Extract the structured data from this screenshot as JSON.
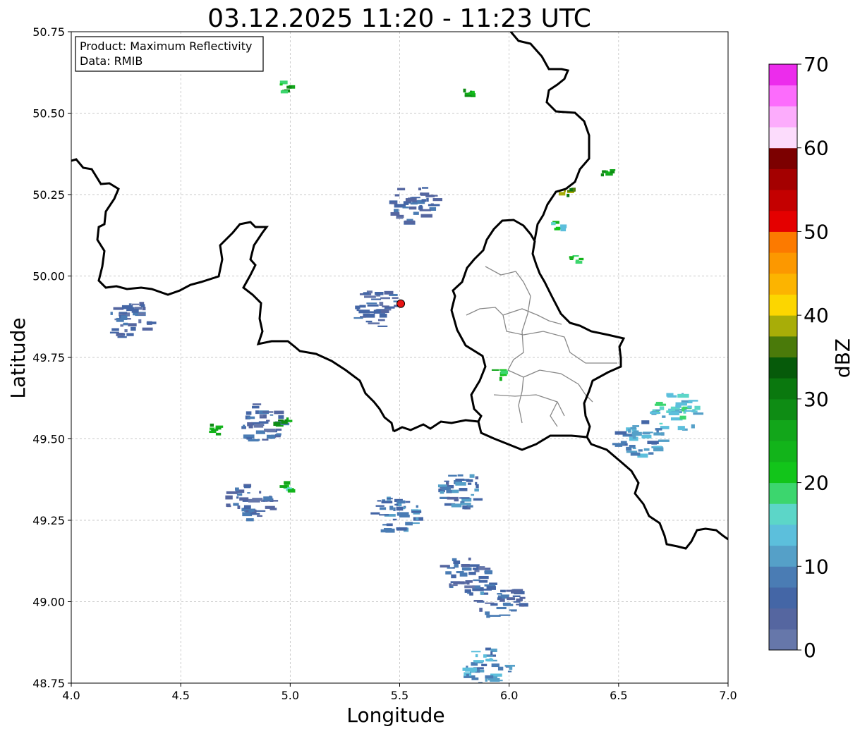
{
  "chart_data": {
    "type": "heatmap",
    "title": "03.12.2025 11:20 - 11:23 UTC",
    "xlabel": "Longitude",
    "ylabel": "Latitude",
    "xlim": [
      4.0,
      7.0
    ],
    "ylim": [
      48.75,
      50.75
    ],
    "x_ticks": [
      "4.0",
      "4.5",
      "5.0",
      "5.5",
      "6.0",
      "6.5",
      "7.0"
    ],
    "y_ticks": [
      "48.75",
      "49.00",
      "49.25",
      "49.50",
      "49.75",
      "50.00",
      "50.25",
      "50.50",
      "50.75"
    ],
    "grid": true,
    "annotation_lines": [
      "Product: Maximum Reflectivity",
      "Data: RMIB"
    ],
    "radar_site": {
      "lon": 5.505,
      "lat": 49.915
    },
    "colorbar": {
      "label": "dBZ",
      "min": 0,
      "max": 70,
      "ticks": [
        "0",
        "10",
        "20",
        "30",
        "40",
        "50",
        "60",
        "70"
      ],
      "colors": [
        "#6677aa",
        "#5566a0",
        "#4466a6",
        "#4a7cb4",
        "#55a0c8",
        "#5cbfdc",
        "#5cd6c8",
        "#3cd66e",
        "#12c51a",
        "#12b41a",
        "#12a61a",
        "#0e8c14",
        "#0a780e",
        "#065a0a",
        "#4a7a0a",
        "#a8ad08",
        "#fcd600",
        "#fcb400",
        "#fc9800",
        "#fc7a00",
        "#e40000",
        "#c40000",
        "#a40000",
        "#7c0000",
        "#fcdcfc",
        "#fcacfc",
        "#fc6cfc",
        "#ec2cec"
      ]
    },
    "echo_regions": [
      {
        "lon": 5.8,
        "lat": 49.34,
        "dbz": 8
      },
      {
        "lon": 5.48,
        "lat": 49.27,
        "dbz": 9
      },
      {
        "lon": 5.9,
        "lat": 48.8,
        "dbz": 10
      },
      {
        "lon": 5.96,
        "lat": 49.0,
        "dbz": 7
      },
      {
        "lon": 5.8,
        "lat": 49.08,
        "dbz": 6
      },
      {
        "lon": 5.57,
        "lat": 50.22,
        "dbz": 6
      },
      {
        "lon": 5.4,
        "lat": 49.9,
        "dbz": 5
      },
      {
        "lon": 4.87,
        "lat": 49.55,
        "dbz": 6
      },
      {
        "lon": 4.82,
        "lat": 49.3,
        "dbz": 6
      },
      {
        "lon": 4.28,
        "lat": 49.86,
        "dbz": 5
      },
      {
        "lon": 6.3,
        "lat": 50.05,
        "dbz": 22
      },
      {
        "lon": 6.22,
        "lat": 50.15,
        "dbz": 18
      },
      {
        "lon": 6.45,
        "lat": 50.32,
        "dbz": 25
      },
      {
        "lon": 4.98,
        "lat": 50.58,
        "dbz": 24
      },
      {
        "lon": 5.82,
        "lat": 50.56,
        "dbz": 26
      },
      {
        "lon": 4.97,
        "lat": 49.55,
        "dbz": 28
      },
      {
        "lon": 4.66,
        "lat": 49.53,
        "dbz": 26
      },
      {
        "lon": 4.98,
        "lat": 49.35,
        "dbz": 22
      },
      {
        "lon": 6.77,
        "lat": 49.58,
        "dbz": 14
      },
      {
        "lon": 6.6,
        "lat": 49.5,
        "dbz": 10
      },
      {
        "lon": 5.95,
        "lat": 49.7,
        "dbz": 24
      },
      {
        "lon": 6.27,
        "lat": 50.26,
        "dbz": 35
      }
    ]
  }
}
